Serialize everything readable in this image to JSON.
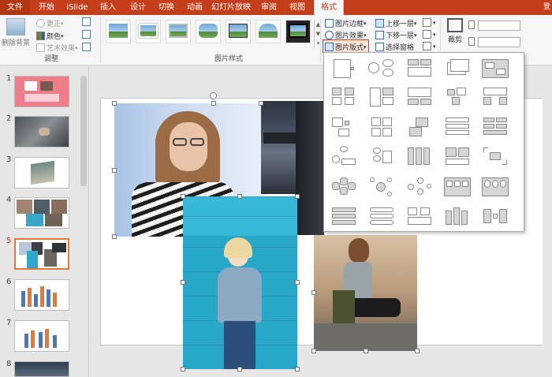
{
  "tabs": [
    {
      "label": "文件",
      "active": false
    },
    {
      "label": "开始",
      "active": false
    },
    {
      "label": "iSlide",
      "active": false
    },
    {
      "label": "插入",
      "active": false
    },
    {
      "label": "设计",
      "active": false
    },
    {
      "label": "切换",
      "active": false
    },
    {
      "label": "动画",
      "active": false
    },
    {
      "label": "幻灯片放映",
      "active": false
    },
    {
      "label": "审阅",
      "active": false
    },
    {
      "label": "视图",
      "active": false
    },
    {
      "label": "格式",
      "active": true
    }
  ],
  "user_label": "登",
  "ribbon": {
    "adjust": {
      "remove_bg": "删除背景",
      "corrections": "更正",
      "color": "颜色",
      "artistic": "艺术效果",
      "label": "调整"
    },
    "picture_styles": {
      "label": "图片样式"
    },
    "arrange": {
      "border": "图片边框",
      "effects": "图片效果",
      "layout": "图片版式",
      "bring_forward": "上移一层",
      "send_backward": "下移一层",
      "selection_pane": "选择窗格"
    },
    "size": {
      "crop": "裁剪"
    }
  },
  "thumbnails": [
    {
      "num": "1",
      "active": false
    },
    {
      "num": "2",
      "active": false
    },
    {
      "num": "3",
      "active": false
    },
    {
      "num": "4",
      "active": false
    },
    {
      "num": "5",
      "active": true
    },
    {
      "num": "6",
      "active": false
    },
    {
      "num": "7",
      "active": false
    },
    {
      "num": "8",
      "active": false
    }
  ],
  "colors": {
    "accent": "#c43e1c",
    "ribbon_bg": "#f6f6f6",
    "selection_orange": "#e2793b"
  }
}
